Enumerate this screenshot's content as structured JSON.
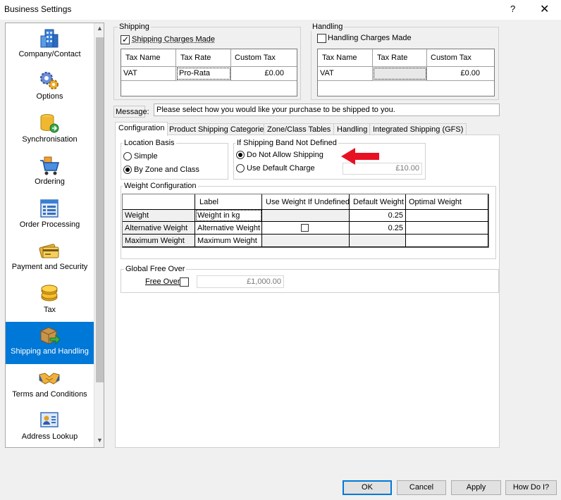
{
  "window": {
    "title": "Business Settings",
    "help_glyph": "?",
    "close_glyph": "✕"
  },
  "sidebar": {
    "items": [
      {
        "label": "Company/Contact",
        "icon": "building-icon"
      },
      {
        "label": "Options",
        "icon": "gears-icon"
      },
      {
        "label": "Synchronisation",
        "icon": "database-sync-icon"
      },
      {
        "label": "Ordering",
        "icon": "shopping-cart-icon"
      },
      {
        "label": "Order Processing",
        "icon": "order-form-icon"
      },
      {
        "label": "Payment and Security",
        "icon": "credit-card-icon"
      },
      {
        "label": "Tax",
        "icon": "coins-icon"
      },
      {
        "label": "Shipping and Handling",
        "icon": "package-arrow-icon"
      },
      {
        "label": "Terms and Conditions",
        "icon": "handshake-icon"
      },
      {
        "label": "Address Lookup",
        "icon": "address-card-icon"
      }
    ],
    "active_index": 7
  },
  "shipping": {
    "group_title": "Shipping",
    "charges_label": "Shipping Charges Made",
    "charges_checked": true,
    "columns": [
      "Tax Name",
      "Tax Rate",
      "Custom Tax"
    ],
    "row": {
      "tax_name": "VAT",
      "tax_rate": "Pro-Rata",
      "custom_tax": "£0.00"
    }
  },
  "handling": {
    "group_title": "Handling",
    "charges_label": "Handling Charges Made",
    "charges_checked": false,
    "columns": [
      "Tax Name",
      "Tax Rate",
      "Custom Tax"
    ],
    "row": {
      "tax_name": "VAT",
      "tax_rate": "",
      "custom_tax": "£0.00"
    }
  },
  "message": {
    "label": "Message:",
    "value": "Please select how you would like your purchase to be shipped to you."
  },
  "tabs": [
    {
      "label": "Configuration",
      "active": true
    },
    {
      "label": "Product Shipping Categories",
      "active": false
    },
    {
      "label": "Zone/Class Tables",
      "active": false
    },
    {
      "label": "Handling",
      "active": false
    },
    {
      "label": "Integrated Shipping (GFS)",
      "active": false
    }
  ],
  "location_basis": {
    "title": "Location Basis",
    "options": [
      "Simple",
      "By Zone and Class"
    ],
    "selected": "By Zone and Class"
  },
  "shipping_band": {
    "title": "If Shipping Band Not Defined",
    "options": [
      "Do Not Allow Shipping",
      "Use Default Charge"
    ],
    "selected": "Do Not Allow Shipping",
    "default_charge": "£10.00"
  },
  "weight_config": {
    "title": "Weight Configuration",
    "columns": [
      "Label",
      "Use Weight If Undefined",
      "Default Weight",
      "Optimal Weight"
    ],
    "rows": [
      {
        "name": "Weight",
        "label": "Weight in kg",
        "use_if_undefined": "",
        "default_weight": "0.25",
        "optimal_weight": ""
      },
      {
        "name": "Alternative Weight",
        "label": "Alternative Weight",
        "use_if_undefined": "checkbox",
        "default_weight": "0.25",
        "optimal_weight": ""
      },
      {
        "name": "Maximum Weight",
        "label": "Maximum Weight",
        "use_if_undefined": "",
        "default_weight": "",
        "optimal_weight": ""
      }
    ]
  },
  "free_over": {
    "title": "Global Free Over",
    "label": "Free Over",
    "checked": false,
    "value": "£1,000.00"
  },
  "buttons": {
    "ok": "OK",
    "cancel": "Cancel",
    "apply": "Apply",
    "help": "How Do I?"
  },
  "colors": {
    "accent": "#0078d7",
    "annotation_arrow": "#e81123"
  }
}
